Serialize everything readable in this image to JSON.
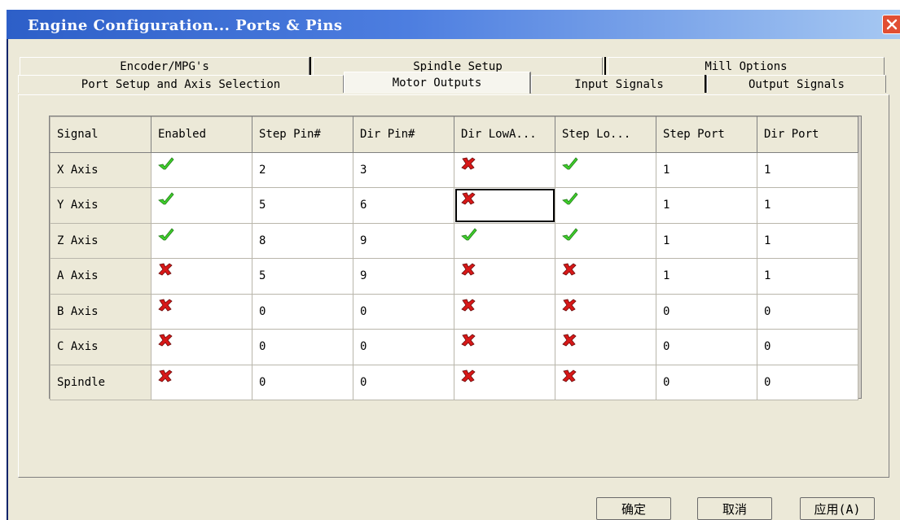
{
  "window": {
    "title": "Engine Configuration... Ports & Pins"
  },
  "tabs": {
    "row1": [
      "Encoder/MPG's",
      "Spindle Setup",
      "Mill Options"
    ],
    "row2": [
      "Port Setup and Axis Selection",
      "Motor Outputs",
      "Input Signals",
      "Output Signals"
    ],
    "active": "Motor Outputs"
  },
  "grid": {
    "columns": [
      "Signal",
      "Enabled",
      "Step Pin#",
      "Dir Pin#",
      "Dir LowA...",
      "Step Lo...",
      "Step Port",
      "Dir Port"
    ],
    "rows": [
      {
        "signal": "X Axis",
        "enabled": "check",
        "step_pin": "2",
        "dir_pin": "3",
        "dir_low": "cross",
        "step_low": "check",
        "step_port": "1",
        "dir_port": "1"
      },
      {
        "signal": "Y Axis",
        "enabled": "check",
        "step_pin": "5",
        "dir_pin": "6",
        "dir_low": "cross",
        "step_low": "check",
        "step_port": "1",
        "dir_port": "1"
      },
      {
        "signal": "Z Axis",
        "enabled": "check",
        "step_pin": "8",
        "dir_pin": "9",
        "dir_low": "check",
        "step_low": "check",
        "step_port": "1",
        "dir_port": "1"
      },
      {
        "signal": "A Axis",
        "enabled": "cross",
        "step_pin": "5",
        "dir_pin": "9",
        "dir_low": "cross",
        "step_low": "cross",
        "step_port": "1",
        "dir_port": "1"
      },
      {
        "signal": "B Axis",
        "enabled": "cross",
        "step_pin": "0",
        "dir_pin": "0",
        "dir_low": "cross",
        "step_low": "cross",
        "step_port": "0",
        "dir_port": "0"
      },
      {
        "signal": "C Axis",
        "enabled": "cross",
        "step_pin": "0",
        "dir_pin": "0",
        "dir_low": "cross",
        "step_low": "cross",
        "step_port": "0",
        "dir_port": "0"
      },
      {
        "signal": "Spindle",
        "enabled": "cross",
        "step_pin": "0",
        "dir_pin": "0",
        "dir_low": "cross",
        "step_low": "cross",
        "step_port": "0",
        "dir_port": "0"
      }
    ]
  },
  "buttons": {
    "ok": "确定",
    "cancel": "取消",
    "apply": "应用(A)"
  },
  "colors": {
    "check": "#3fcf2c",
    "cross": "#d81818",
    "titlebar": "#2d5fc8",
    "dialog": "#ece9d8"
  }
}
